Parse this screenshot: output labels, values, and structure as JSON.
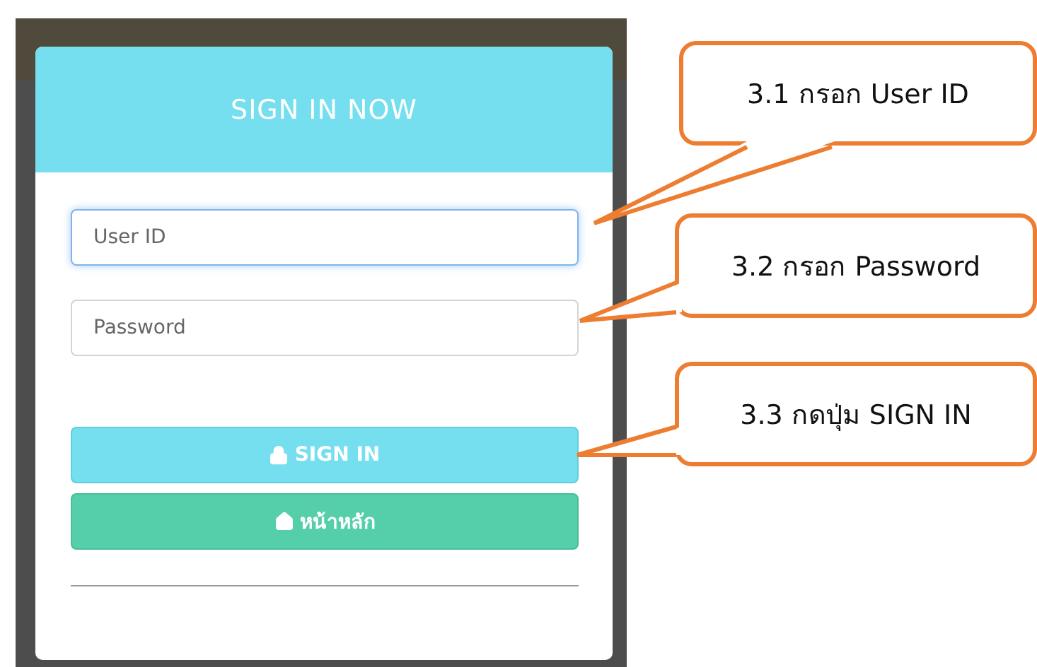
{
  "modal": {
    "title": "SIGN IN NOW",
    "fields": [
      {
        "placeholder": "User ID",
        "focused": true
      },
      {
        "placeholder": "Password",
        "focused": false
      }
    ],
    "buttons": [
      {
        "kind": "signin",
        "label": "SIGN IN"
      },
      {
        "kind": "home",
        "label": "หน้าหลัก"
      }
    ]
  },
  "callouts": [
    {
      "text": "3.1 กรอก User ID"
    },
    {
      "text": "3.2 กรอก Password"
    },
    {
      "text": "3.3 กดปุ่ม SIGN IN"
    }
  ]
}
